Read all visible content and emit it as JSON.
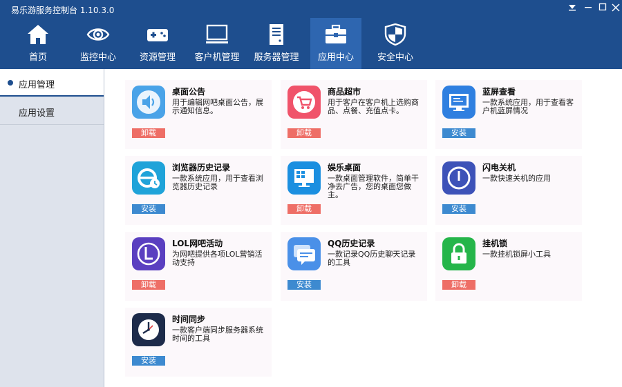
{
  "window": {
    "title": "易乐游服务控制台 1.10.3.0"
  },
  "nav": [
    {
      "label": "首页",
      "icon": "home-icon"
    },
    {
      "label": "监控中心",
      "icon": "eye-icon"
    },
    {
      "label": "资源管理",
      "icon": "gamepad-icon"
    },
    {
      "label": "客户机管理",
      "icon": "monitor-icon"
    },
    {
      "label": "服务器管理",
      "icon": "server-icon"
    },
    {
      "label": "应用中心",
      "icon": "toolbox-icon",
      "active": true
    },
    {
      "label": "安全中心",
      "icon": "shield-icon"
    }
  ],
  "sidebar": {
    "items": [
      {
        "label": "应用管理",
        "active": true
      },
      {
        "label": "应用设置"
      }
    ]
  },
  "apps": [
    {
      "name": "桌面公告",
      "desc": "用于编辑网吧桌面公告，展示通知信息。",
      "action": "卸载",
      "icon": "speaker-icon",
      "color": "#4aa3e8"
    },
    {
      "name": "商品超市",
      "desc": "用于客户在客户机上选购商品、点餐、充值点卡。",
      "action": "卸载",
      "icon": "shopping-cart-icon",
      "color": "#f0536a"
    },
    {
      "name": "蓝屏查看",
      "desc": "一款系统应用，用于查看客户机蓝屏情况",
      "action": "安装",
      "icon": "blue-screen-icon",
      "color": "#2f7fe0"
    },
    {
      "name": "浏览器历史记录",
      "desc": "一款系统应用，用于查看浏览器历史记录",
      "action": "安装",
      "icon": "browser-history-icon",
      "color": "#1fa3d9"
    },
    {
      "name": "娱乐桌面",
      "desc": "一款桌面管理软件，简单干净去广告，您的桌面您做主。",
      "action": "卸载",
      "icon": "desktop-icon",
      "color": "#1b8fe0"
    },
    {
      "name": "闪电关机",
      "desc": "一款快速关机的应用",
      "action": "安装",
      "icon": "power-icon",
      "color": "#3d52b8"
    },
    {
      "name": "LOL网吧活动",
      "desc": "为网吧提供各项LOL营销活动支持",
      "action": "卸载",
      "icon": "lol-icon",
      "color": "#5a3fc0"
    },
    {
      "name": "QQ历史记录",
      "desc": "一款记录QQ历史聊天记录的工具",
      "action": "安装",
      "icon": "chat-icon",
      "color": "#4a90e8"
    },
    {
      "name": "挂机锁",
      "desc": "一款挂机锁屏小工具",
      "action": "卸载",
      "icon": "lock-icon",
      "color": "#25b54a"
    },
    {
      "name": "时间同步",
      "desc": "一款客户端同步服务器系统时间的工具",
      "action": "安装",
      "icon": "clock-icon",
      "color": "#1d2b4a"
    }
  ]
}
